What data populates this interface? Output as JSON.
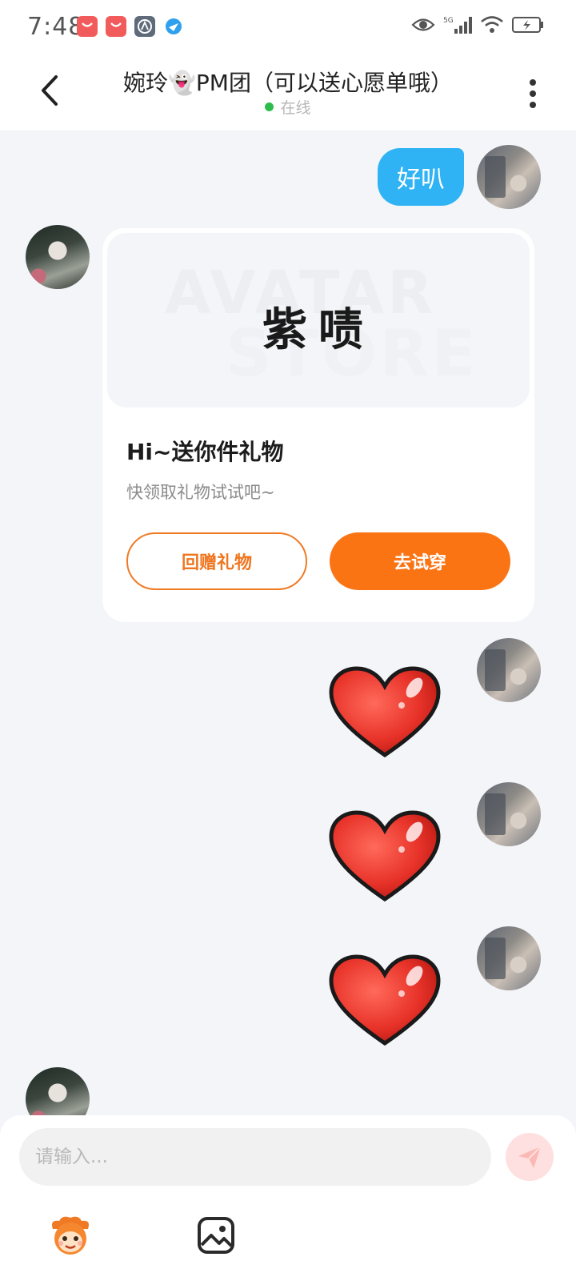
{
  "status_bar": {
    "time": "7:48",
    "icons": [
      "app-store-icon",
      "app-store-icon",
      "settings-app-icon",
      "browser-app-icon",
      "eye-icon",
      "signal-5g-icon",
      "wifi-icon",
      "battery-charging-icon"
    ]
  },
  "header": {
    "title": "婉玲👻PM团（可以送心愿单哦）",
    "status": "在线",
    "status_color": "#2ebd4d"
  },
  "messages": [
    {
      "from": "me",
      "type": "text",
      "text": "好叭"
    },
    {
      "from": "her",
      "type": "gift_card",
      "image_watermark_top": "AVATAR",
      "image_watermark_bottom": "STORE",
      "gift_name": "紫啧",
      "title": "Hi~送你件礼物",
      "subtitle": "快领取礼物试试吧~",
      "return_button": "回赠礼物",
      "try_button": "去试穿"
    },
    {
      "from": "me",
      "type": "sticker",
      "sticker": "heart-icon"
    },
    {
      "from": "me",
      "type": "sticker",
      "sticker": "heart-icon"
    },
    {
      "from": "me",
      "type": "sticker",
      "sticker": "heart-icon"
    }
  ],
  "input": {
    "placeholder": "请输入...",
    "value": ""
  },
  "colors": {
    "bubble_me": "#2fb3f4",
    "accent_orange": "#fb7414",
    "background": "#f3f5f9"
  }
}
